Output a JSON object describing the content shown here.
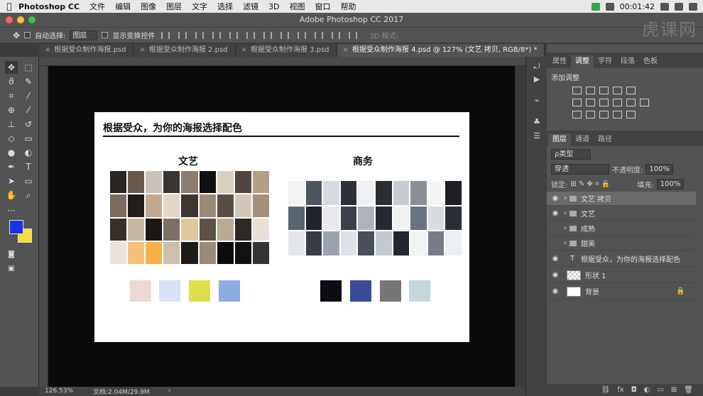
{
  "menubar": {
    "app_name": "Photoshop CC",
    "items": [
      "文件",
      "编辑",
      "图像",
      "图层",
      "文字",
      "选择",
      "滤镜",
      "3D",
      "视图",
      "窗口",
      "帮助"
    ],
    "time": "00:01:42"
  },
  "window": {
    "title": "Adobe Photoshop CC 2017"
  },
  "options_bar": {
    "auto_select_label": "自动选择:",
    "auto_select_value": "图层",
    "show_transform_label": "显示变换控件",
    "mode_3d_label": "3D 模式:"
  },
  "tabs": [
    {
      "label": "根据受众制作海报.psd"
    },
    {
      "label": "根据受众制作海报 2.psd"
    },
    {
      "label": "根据受众制作海报 3.psd"
    },
    {
      "label": "根据受众制作海报 4.psd @ 127% (文艺 拷贝, RGB/8*) *"
    }
  ],
  "document": {
    "headline": "根据受众，为你的海报选择配色",
    "left_title": "文艺",
    "right_title": "商务",
    "left_palette": [
      "#ecdad2",
      "#d7e3f9",
      "#dde04a",
      "#8cace4"
    ],
    "right_palette": [
      "#0b0d12",
      "#3a4b98",
      "#767578",
      "#c5d6dc"
    ]
  },
  "status": {
    "zoom": "126.53%",
    "doc_size": "文档:2.04M/29.9M"
  },
  "colors": {
    "foreground": "#1634e6",
    "background": "#f7dd3a"
  },
  "panels": {
    "tabs": [
      "属性",
      "调整",
      "字符",
      "段落",
      "色板"
    ],
    "active_tab": "调整",
    "adjust_title": "添加调整",
    "layer_tabs": [
      "图层",
      "通道",
      "路径"
    ],
    "filter_label": "ρ类型",
    "blend_mode": "穿透",
    "opacity_label": "不透明度:",
    "opacity_value": "100%",
    "lock_label": "锁定:",
    "fill_label": "填充:",
    "fill_value": "100%",
    "layers": [
      {
        "name": "文艺 拷贝",
        "kind": "folder",
        "visible": true,
        "selected": true
      },
      {
        "name": "文艺",
        "kind": "folder",
        "visible": true,
        "selected": false
      },
      {
        "name": "成熟",
        "kind": "folder",
        "visible": false,
        "selected": false
      },
      {
        "name": "甜美",
        "kind": "folder",
        "visible": false,
        "selected": false
      },
      {
        "name": "根据受众，为你的海报选择配色",
        "kind": "text",
        "visible": true,
        "selected": false
      },
      {
        "name": "形状 1",
        "kind": "shape",
        "visible": true,
        "selected": false
      },
      {
        "name": "背景",
        "kind": "background",
        "visible": true,
        "selected": false
      }
    ]
  },
  "watermark": "虎课网"
}
